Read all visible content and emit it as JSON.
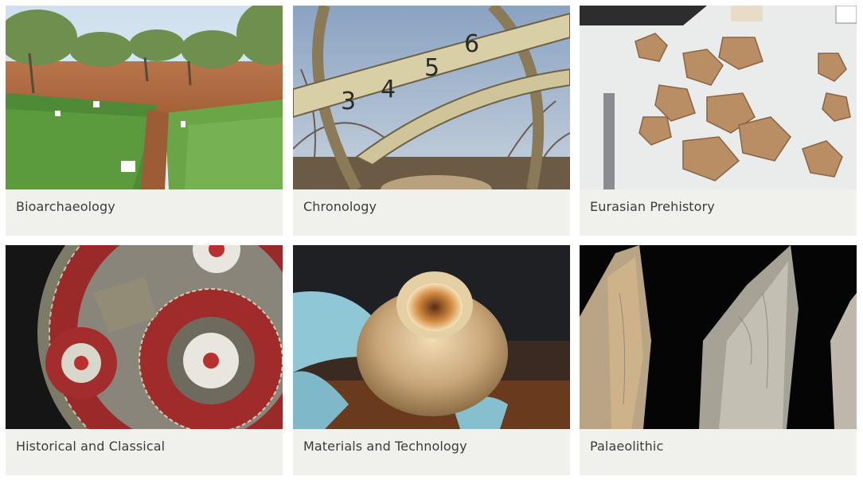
{
  "cards": [
    {
      "label": "Bioarchaeology",
      "image": "field-crops-image"
    },
    {
      "label": "Chronology",
      "image": "armillary-sphere-image"
    },
    {
      "label": "Eurasian Prehistory",
      "image": "bone-fragments-image"
    },
    {
      "label": "Historical and Classical",
      "image": "garnet-brooch-image"
    },
    {
      "label": "Materials and Technology",
      "image": "glass-vessel-image"
    },
    {
      "label": "Palaeolithic",
      "image": "flint-blades-image"
    }
  ],
  "colors": {
    "card_background": "#f0f0ec",
    "label_text": "#3b3b3b"
  }
}
